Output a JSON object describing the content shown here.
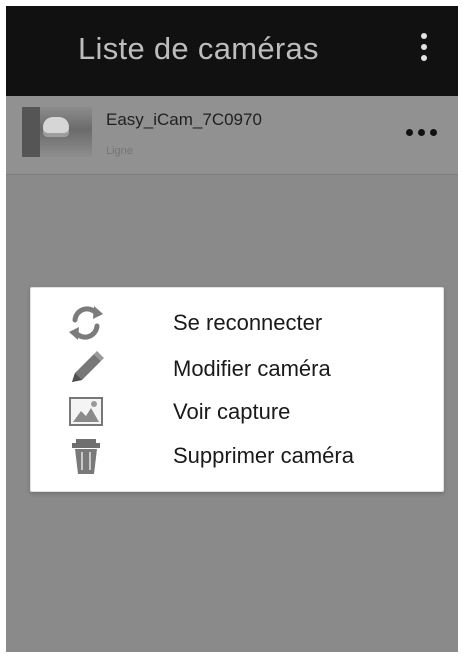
{
  "topbar": {
    "title": "Liste de caméras"
  },
  "camera": {
    "name": "Easy_iCam_7C0970",
    "status": "Ligne"
  },
  "context_menu": {
    "items": [
      {
        "label": "Se reconnecter",
        "icon": "refresh-icon"
      },
      {
        "label": "Modifier caméra",
        "icon": "pencil-icon"
      },
      {
        "label": "Voir capture",
        "icon": "image-icon"
      },
      {
        "label": "Supprimer caméra",
        "icon": "trash-icon"
      }
    ]
  },
  "colors": {
    "topbar_background": "#111111",
    "screen_background": "#8a8a8a",
    "menu_background": "#ffffff",
    "icon_gray": "#7b7b7b"
  }
}
